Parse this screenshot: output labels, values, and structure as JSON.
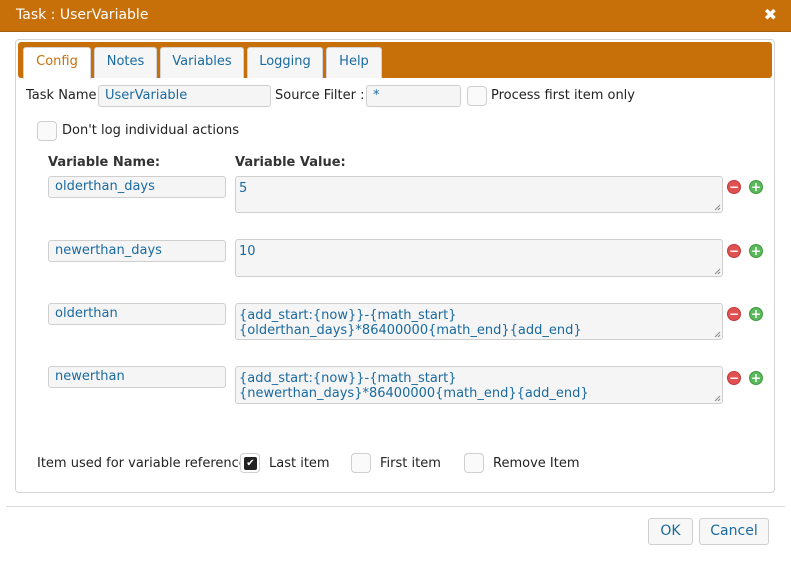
{
  "window": {
    "title": "Task : UserVariable",
    "close_glyph": "✖"
  },
  "tabs": [
    "Config",
    "Notes",
    "Variables",
    "Logging",
    "Help"
  ],
  "config": {
    "task_name_label": "Task Name:",
    "task_name_value": "UserVariable",
    "source_filter_label": "Source Filter :",
    "source_filter_value": "*",
    "process_first_label": "Process first item only",
    "dont_log_label": "Don't log individual actions"
  },
  "variables": {
    "name_header": "Variable Name:",
    "value_header": "Variable Value:",
    "rows": [
      {
        "name": "olderthan_days",
        "value": "5"
      },
      {
        "name": "newerthan_days",
        "value": "10"
      },
      {
        "name": "olderthan",
        "value": "{add_start:{now}}-{math_start}{olderthan_days}*86400000{math_end}{add_end}"
      },
      {
        "name": "newerthan",
        "value": "{add_start:{now}}-{math_start}{newerthan_days}*86400000{math_end}{add_end}"
      }
    ]
  },
  "reference": {
    "label": "Item used for variable reference:",
    "options": [
      {
        "label": "Last item",
        "checked": true
      },
      {
        "label": "First item",
        "checked": false
      },
      {
        "label": "Remove Item",
        "checked": false
      }
    ]
  },
  "buttons": {
    "ok": "OK",
    "cancel": "Cancel"
  },
  "colors": {
    "accent": "#c7700a",
    "link": "#1a6aa0",
    "remove": "#e05252",
    "add": "#5cb85c"
  }
}
